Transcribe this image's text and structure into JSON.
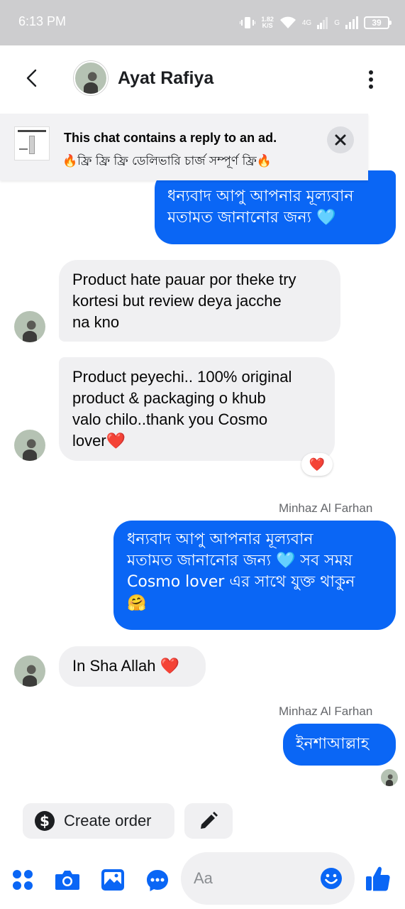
{
  "status_bar": {
    "time": "6:13 PM",
    "speed_value": "1.82",
    "speed_unit": "K/S",
    "network_1": "4G",
    "network_2": "G",
    "battery": "39"
  },
  "header": {
    "contact_name": "Ayat Rafiya"
  },
  "ad_banner": {
    "title": "This chat contains a reply to an ad.",
    "subtitle": "🔥ফ্রি ফ্রি ফ্রি  ডেলিভারি চার্জ সম্পূর্ণ ফ্রি🔥"
  },
  "messages": {
    "m1": {
      "direction": "outgoing",
      "text": "ধন্যবাদ আপু আপনার মূল্যবান\nমতামত জানানোর জন্য 🩵"
    },
    "m2": {
      "direction": "incoming",
      "text": "Product hate pauar por theke try\nkortesi but review deya jacche\nna kno"
    },
    "m3": {
      "direction": "incoming",
      "text": "Product peyechi.. 100% original\nproduct & packaging o khub\nvalo chilo..thank you Cosmo\nlover❤️",
      "reaction": "❤️"
    },
    "m4": {
      "direction": "outgoing",
      "sender": "Minhaz Al Farhan",
      "text": "ধন্যবাদ আপু আপনার মূল্যবান\nমতামত জানানোর জন্য 🩵 সব সময়\nCosmo lover এর সাথে যুক্ত থাকুন\n🤗"
    },
    "m5": {
      "direction": "incoming",
      "text": "In Sha Allah ❤️"
    },
    "m6": {
      "direction": "outgoing",
      "sender": "Minhaz Al Farhan",
      "text": "ইনশাআল্লাহ"
    }
  },
  "actions": {
    "create_order": "Create order"
  },
  "composer": {
    "placeholder": "Aa"
  },
  "colors": {
    "accent": "#0a66f5",
    "incoming_bubble": "#f0f0f2",
    "status_bar": "#cdcdcf"
  },
  "icons": [
    "back-arrow-icon",
    "more-vertical-icon",
    "close-icon",
    "dollar-icon",
    "pencil-icon",
    "apps-grid-icon",
    "camera-icon",
    "gallery-icon",
    "chat-bubble-icon",
    "emoji-icon",
    "thumbs-up-icon"
  ]
}
